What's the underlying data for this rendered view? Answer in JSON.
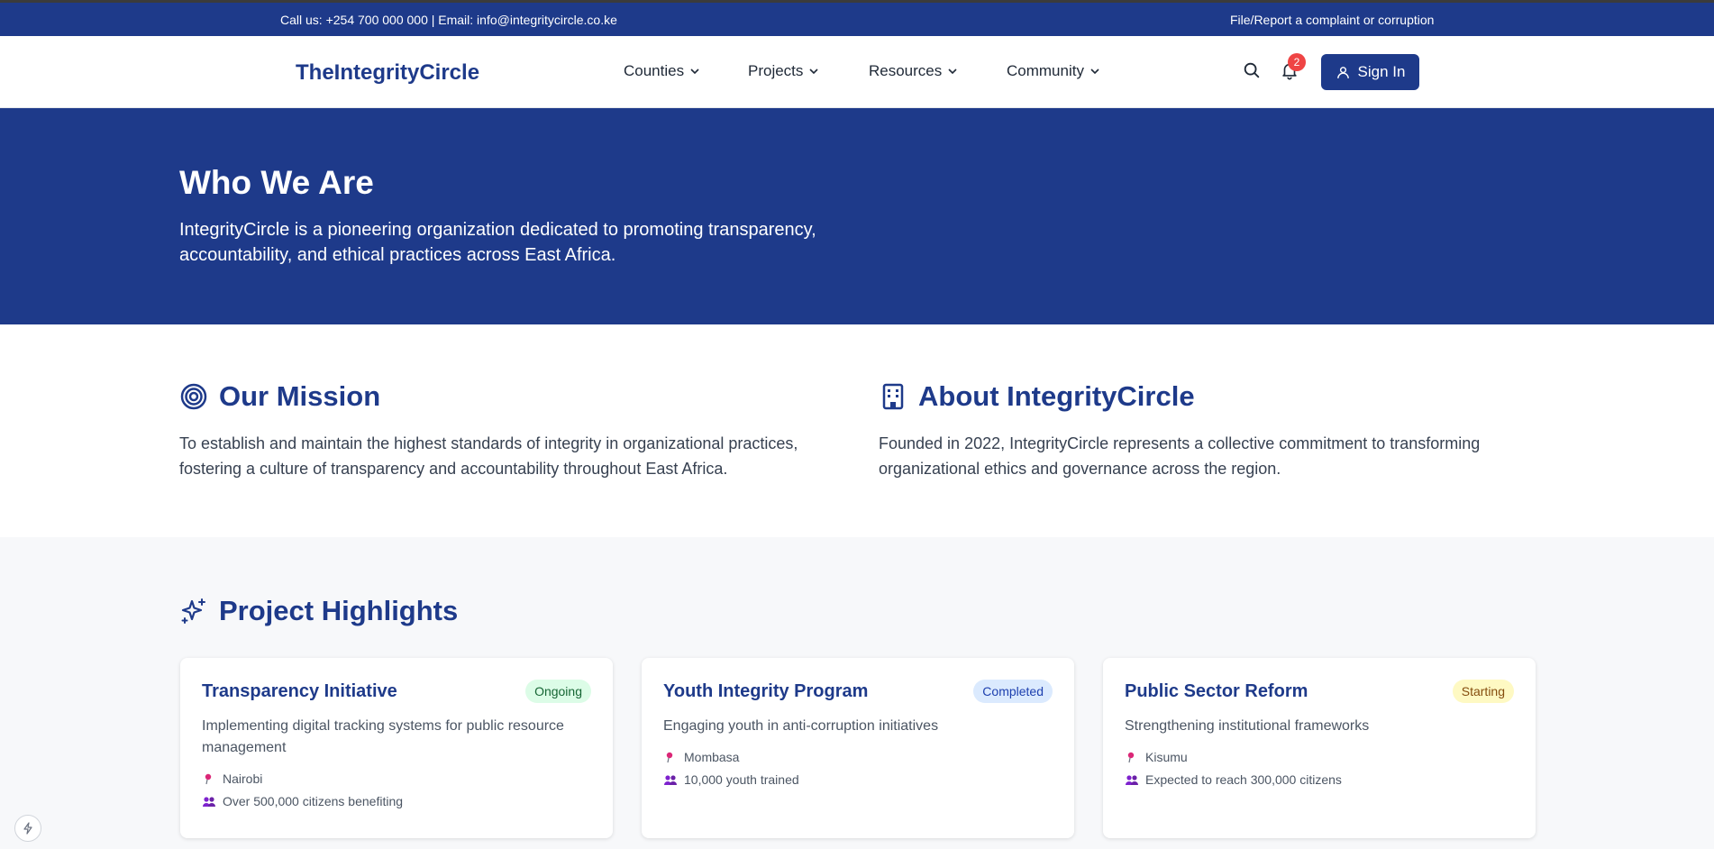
{
  "topbar": {
    "contact": "Call us: +254 700 000 000 | Email: info@integritycircle.co.ke",
    "report_link": "File/Report a complaint or corruption"
  },
  "nav": {
    "logo": "TheIntegrityCircle",
    "menu": [
      {
        "label": "Counties"
      },
      {
        "label": "Projects"
      },
      {
        "label": "Resources"
      },
      {
        "label": "Community"
      }
    ],
    "notification_count": "2",
    "sign_in": "Sign In"
  },
  "hero": {
    "title": "Who We Are",
    "text": "IntegrityCircle is a pioneering organization dedicated to promoting transparency, accountability, and ethical practices across East Africa."
  },
  "mission": {
    "title": "Our Mission",
    "icon": "target-icon",
    "text": "To establish and maintain the highest standards of integrity in organizational practices, fostering a culture of transparency and accountability throughout East Africa."
  },
  "about": {
    "title": "About IntegrityCircle",
    "icon": "building-icon",
    "text": "Founded in 2022, IntegrityCircle represents a collective commitment to transforming organizational ethics and governance across the region."
  },
  "highlights": {
    "title": "Project Highlights",
    "icon": "sparkles-icon",
    "projects": [
      {
        "title": "Transparency Initiative",
        "status": "Ongoing",
        "description": "Implementing digital tracking systems for public resource management",
        "location": "Nairobi",
        "impact": "Over 500,000 citizens benefiting"
      },
      {
        "title": "Youth Integrity Program",
        "status": "Completed",
        "description": "Engaging youth in anti-corruption initiatives",
        "location": "Mombasa",
        "impact": "10,000 youth trained"
      },
      {
        "title": "Public Sector Reform",
        "status": "Starting",
        "description": "Strengthening institutional frameworks",
        "location": "Kisumu",
        "impact": "Expected to reach 300,000 citizens"
      }
    ]
  },
  "colors": {
    "brand": "#1e3a8a",
    "badge_red": "#ef4444",
    "ongoing": "#dcfce7",
    "completed": "#dbeafe",
    "starting": "#fef9c3"
  }
}
